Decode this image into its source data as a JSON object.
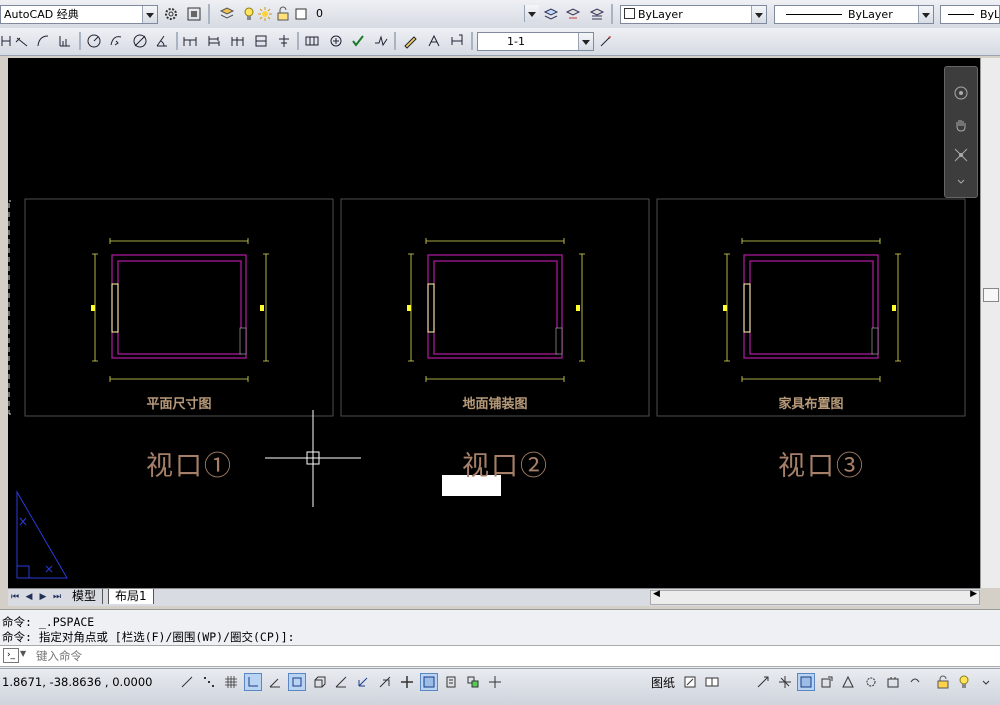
{
  "toolbar1": {
    "workspace": "AutoCAD 经典",
    "layer": "0",
    "color": "ByLayer",
    "linetype": "ByLayer",
    "lineweight": "ByL"
  },
  "toolbar2": {
    "scale": "1-1"
  },
  "viewports": [
    {
      "caption": "平面尺寸图",
      "label": "视口①"
    },
    {
      "caption": "地面铺装图",
      "label": "视口②"
    },
    {
      "caption": "家具布置图",
      "label": "视口③"
    }
  ],
  "tabs": {
    "model": "模型",
    "layout": "布局1"
  },
  "command": {
    "line1": "命令:  _.PSPACE",
    "line2": "命令: 指定对角点或 [栏选(F)/圈围(WP)/圈交(CP)]:",
    "placeholder": "键入命令"
  },
  "status": {
    "coords": "1.8671,  -38.8636  , 0.0000",
    "paper": "图纸"
  },
  "colors": {
    "canvas_bg": "#000000",
    "wall": "#b21aa4",
    "dimension": "#e8e83c",
    "caption": "#b79a7a"
  }
}
